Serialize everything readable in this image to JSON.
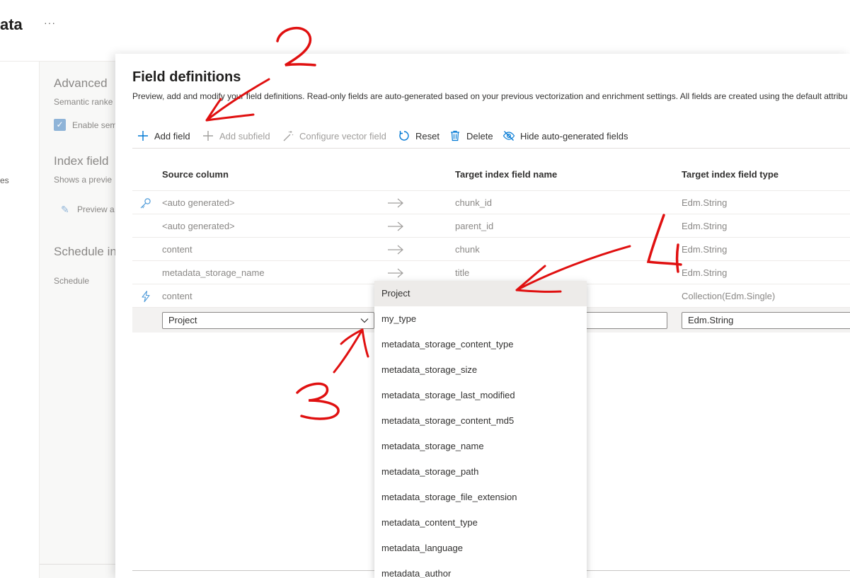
{
  "background": {
    "page_title": "ata",
    "more": "···",
    "left_fragment": "es",
    "advanced_title": "Advanced",
    "advanced_sub": "Semantic ranke",
    "enable_label": "Enable sem",
    "index_fields_title": "Index field",
    "index_fields_sub": "Shows a previe",
    "preview_label": "Preview a",
    "schedule_title": "Schedule in",
    "schedule_label": "Schedule"
  },
  "panel": {
    "title": "Field definitions",
    "description": "Preview, add and modify your field definitions. Read-only fields are auto-generated based on your previous vectorization and enrichment settings. All fields are created using the default attribu",
    "toolbar": {
      "add_field": "Add field",
      "add_subfield": "Add subfield",
      "configure_vector": "Configure vector field",
      "reset": "Reset",
      "delete": "Delete",
      "hide_auto": "Hide auto-generated fields"
    },
    "columns": {
      "source": "Source column",
      "target_name": "Target index field name",
      "target_type": "Target index field type"
    },
    "rows": [
      {
        "icon": "key-icon",
        "source": "<auto generated>",
        "target": "chunk_id",
        "type": "Edm.String"
      },
      {
        "icon": "",
        "source": "<auto generated>",
        "target": "parent_id",
        "type": "Edm.String"
      },
      {
        "icon": "",
        "source": "content",
        "target": "chunk",
        "type": "Edm.String"
      },
      {
        "icon": "",
        "source": "metadata_storage_name",
        "target": "title",
        "type": "Edm.String"
      },
      {
        "icon": "lightning-icon",
        "source": "content",
        "target": "",
        "type": "Collection(Edm.Single)"
      }
    ],
    "edit_row": {
      "source_value": "Project",
      "target_value": "",
      "type_value": "Edm.String"
    }
  },
  "dropdown": {
    "selected": "Project",
    "options": [
      "Project",
      "my_type",
      "metadata_storage_content_type",
      "metadata_storage_size",
      "metadata_storage_last_modified",
      "metadata_storage_content_md5",
      "metadata_storage_name",
      "metadata_storage_path",
      "metadata_storage_file_extension",
      "metadata_content_type",
      "metadata_language",
      "metadata_author"
    ]
  },
  "annotations": [
    "2",
    "3",
    "4"
  ],
  "colors": {
    "accent": "#0078d4",
    "annotation": "#e01010",
    "selected_item_bg": "#edebe9"
  }
}
